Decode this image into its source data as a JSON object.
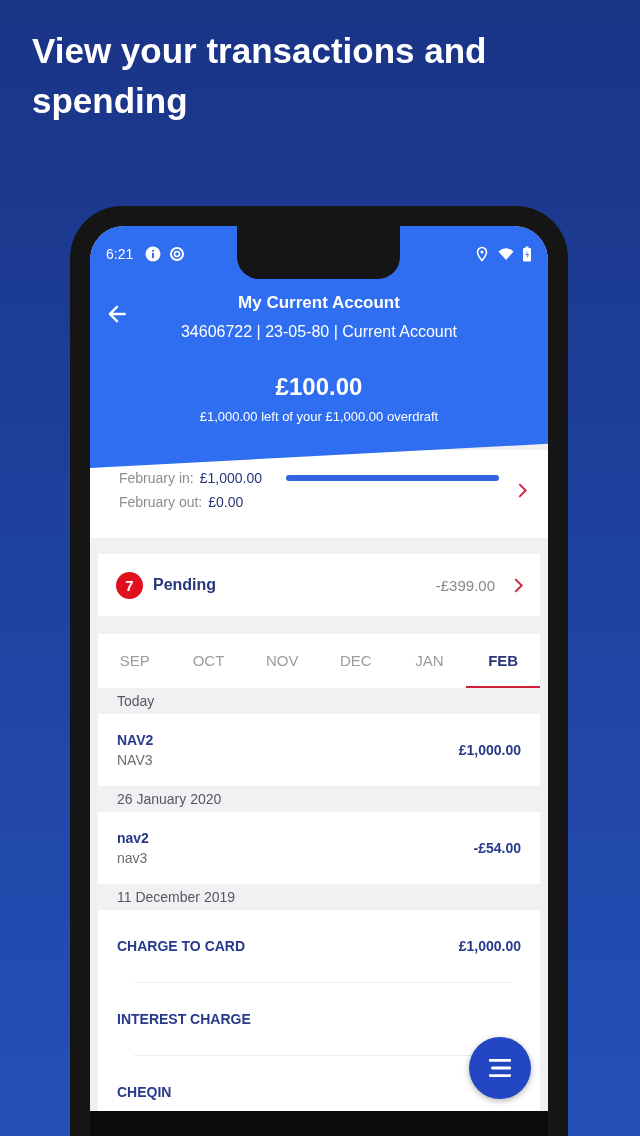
{
  "headline": "View your transactions and spending",
  "status_bar": {
    "time": "6:21"
  },
  "header": {
    "title": "My Current Account",
    "subtitle": "34606722 | 23-05-80 | Current Account",
    "balance": "£100.00",
    "overdraft": "£1,000.00 left of your £1,000.00 overdraft"
  },
  "summary": {
    "in_label": "February in:",
    "in_amount": "£1,000.00",
    "out_label": "February out:",
    "out_amount": "£0.00",
    "level": 1
  },
  "pending": {
    "count": "7",
    "label": "Pending",
    "amount": "-£399.00"
  },
  "tabs": [
    {
      "label": "SEP",
      "selected": false
    },
    {
      "label": "OCT",
      "selected": false
    },
    {
      "label": "NOV",
      "selected": false
    },
    {
      "label": "DEC",
      "selected": false
    },
    {
      "label": "JAN",
      "selected": false
    },
    {
      "label": "FEB",
      "selected": true
    }
  ],
  "sections": [
    {
      "date": "Today",
      "transactions": [
        {
          "name": "NAV2",
          "detail": "NAV3",
          "amount": "£1,000.00"
        }
      ]
    },
    {
      "date": "26 January 2020",
      "transactions": [
        {
          "name": "nav2",
          "detail": "nav3",
          "amount": "-£54.00"
        }
      ]
    },
    {
      "date": "11 December 2019",
      "transactions": [
        {
          "name": "CHARGE TO CARD",
          "amount": "£1,000.00"
        },
        {
          "name": "INTEREST CHARGE"
        },
        {
          "name": "CHEQIN"
        }
      ]
    }
  ]
}
